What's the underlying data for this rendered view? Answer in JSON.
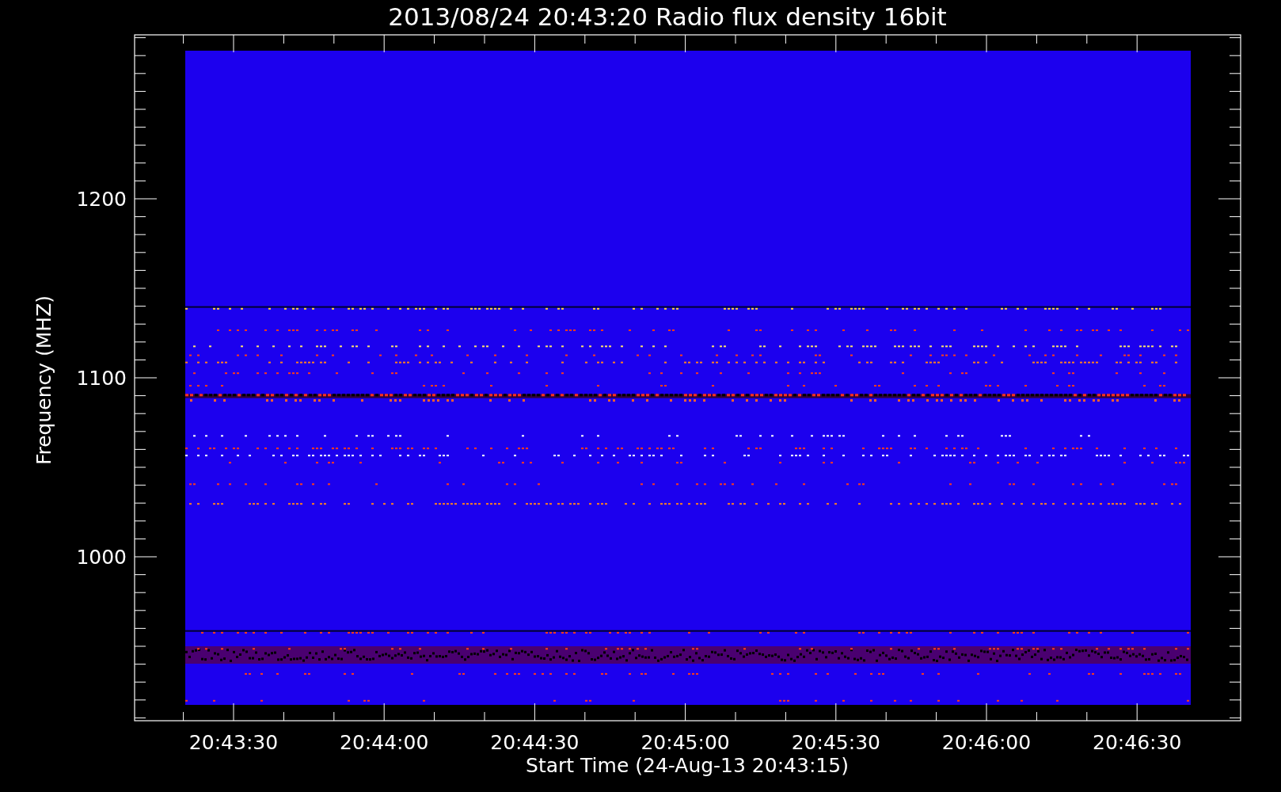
{
  "title": "2013/08/24 20:43:20 Radio flux density 16bit",
  "y_axis": {
    "label": "Frequency (MHZ)",
    "tick_labels": [
      "1200",
      "1100",
      "1000"
    ]
  },
  "x_axis": {
    "label": "Start Time (24-Aug-13 20:43:15)",
    "tick_labels": [
      "20:43:30",
      "20:44:00",
      "20:44:30",
      "20:45:00",
      "20:45:30",
      "20:46:00",
      "20:46:30"
    ]
  }
}
